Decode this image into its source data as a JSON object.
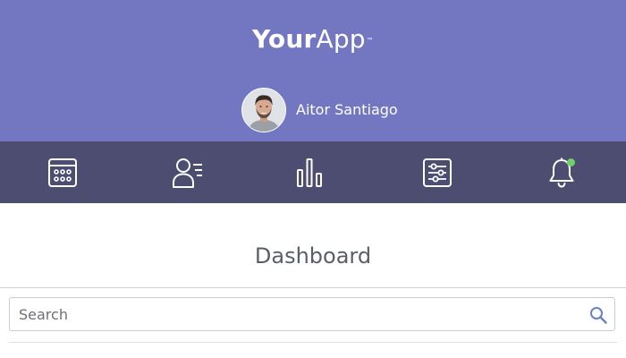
{
  "app": {
    "logo_bold": "Your",
    "logo_light": "App",
    "logo_tm": "™"
  },
  "user": {
    "name": "Aitor Santiago"
  },
  "nav": {
    "items": [
      {
        "icon": "calendar-icon"
      },
      {
        "icon": "contacts-icon"
      },
      {
        "icon": "bar-chart-icon"
      },
      {
        "icon": "settings-sliders-icon"
      },
      {
        "icon": "bell-icon",
        "has_notification": true
      }
    ]
  },
  "main": {
    "title": "Dashboard"
  },
  "search": {
    "placeholder": "Search",
    "value": ""
  },
  "colors": {
    "header_bg": "#7377c2",
    "nav_bg": "#4d4d72",
    "notification_dot": "#6fcf6b",
    "search_icon": "#6b7fc7"
  }
}
